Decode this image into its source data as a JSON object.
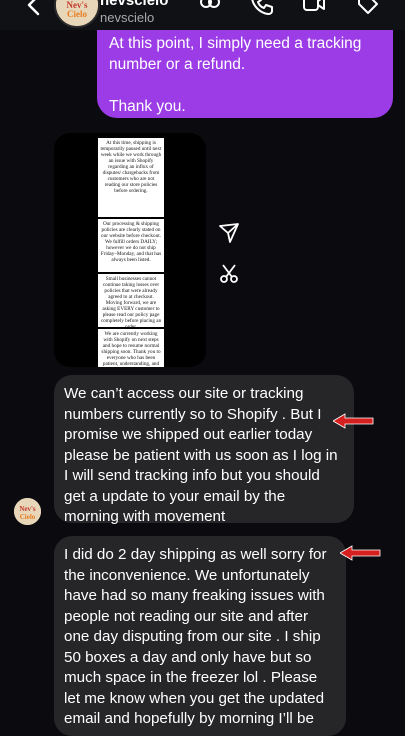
{
  "header": {
    "name": "nevscielo",
    "handle": "nevscielo",
    "avatar_label": "Nev's Cielo"
  },
  "messages": {
    "outgoing": {
      "line1": "At this point, I simply need a tracking number or a refund.",
      "line2": "Thank you."
    },
    "image_notes": [
      "At this time, shipping is temporarily paused until next week while we work through an issue with Shopify regarding an influx of disputes/ chargebacks from customers who are not reading our store policies before ordering.",
      "Our processing & shipping policies are clearly stated on our website before checkout. We fulfill orders DAILY; however we do not ship Friday–Monday, and that has always been listed.",
      "Small businesses cannot continue taking losses over policies that were already agreed to at checkout. Moving forward, we are asking EVERY customer to please read our policy page completely before placing an order.",
      "We are currently working with Shopify on next steps and hope to resume normal shipping soon. Thank you to everyone who has been patient, understanding, and"
    ],
    "incoming1": "We can’t access our site or tracking numbers currently so to Shopify . But I promise we shipped  out earlier today please be patient with us soon as I log in I will send tracking info but you should get a update to your email by the morning with movement",
    "incoming2": "I did do 2 day shipping as well sorry for the inconvenience. We unfortunately have had so many freaking issues with people not reading our site and after one day disputing from our site .  I ship 50 boxes a day and only have but so much space in the freezer lol . Please let me know when you get the updated email and hopefully by morning I’ll be"
  },
  "icons": [
    "back-arrow-icon",
    "call-effects-icon",
    "phone-icon",
    "video-icon",
    "tag-icon",
    "send-icon",
    "reply-icon",
    "red-arrow-icon"
  ],
  "colors": {
    "outgoing_bubble": "#9b3ce7",
    "incoming_bubble": "#262629",
    "annotation_arrow": "#d62020"
  }
}
